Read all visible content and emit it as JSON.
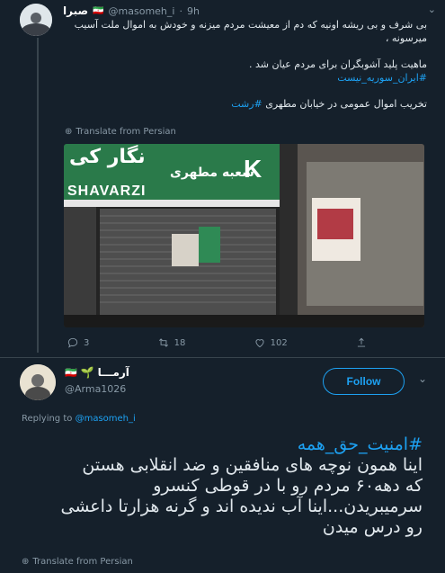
{
  "tweet1": {
    "display_name": "صبرا",
    "handle": "@masomeh_i",
    "time": "9h",
    "flag": "🇮🇷",
    "lines": [
      "بی شرف و بی ریشه اونیه که دم از معیشت مردم میزنه و خودش به اموال ملت آسیب",
      "میرسونه ،",
      "ماهیت پلید آشوبگران برای مردم عیان شد ."
    ],
    "hashtag1": "#ایران_سوریه_نیست",
    "line4": "تخریب اموال عمومی در خیابان مطهری",
    "hashtag2": "#رشت",
    "translate": "Translate from Persian",
    "photo": {
      "sign_fa_top": "نگار کی",
      "sign_fa": "شعبه مطهری",
      "sign_en": "SHAVARZI",
      "sign_letter": "K"
    },
    "actions": {
      "replies": "3",
      "retweets": "18",
      "likes": "102"
    }
  },
  "tweet2": {
    "display_name": "آرمـــا",
    "flag": "🇮🇷",
    "handle": "@Arma1026",
    "follow_label": "Follow",
    "replying_prefix": "Replying to",
    "replying_handle": "@masomeh_i",
    "hashtag": "#امنیت_حق_همه",
    "lines": [
      "اینا همون نوچه های منافقین و ضد انقلابی هستن",
      "که دهه۶۰ مردم رو با در قوطی کنسرو",
      "سرمیبریدن...اینا آب ندیده اند و گرنه هزارتا داعشی",
      "رو درس میدن"
    ],
    "translate": "Translate from Persian"
  },
  "colors": {
    "accent": "#1da1f2",
    "bg": "#15202b",
    "muted": "#8899a6"
  }
}
